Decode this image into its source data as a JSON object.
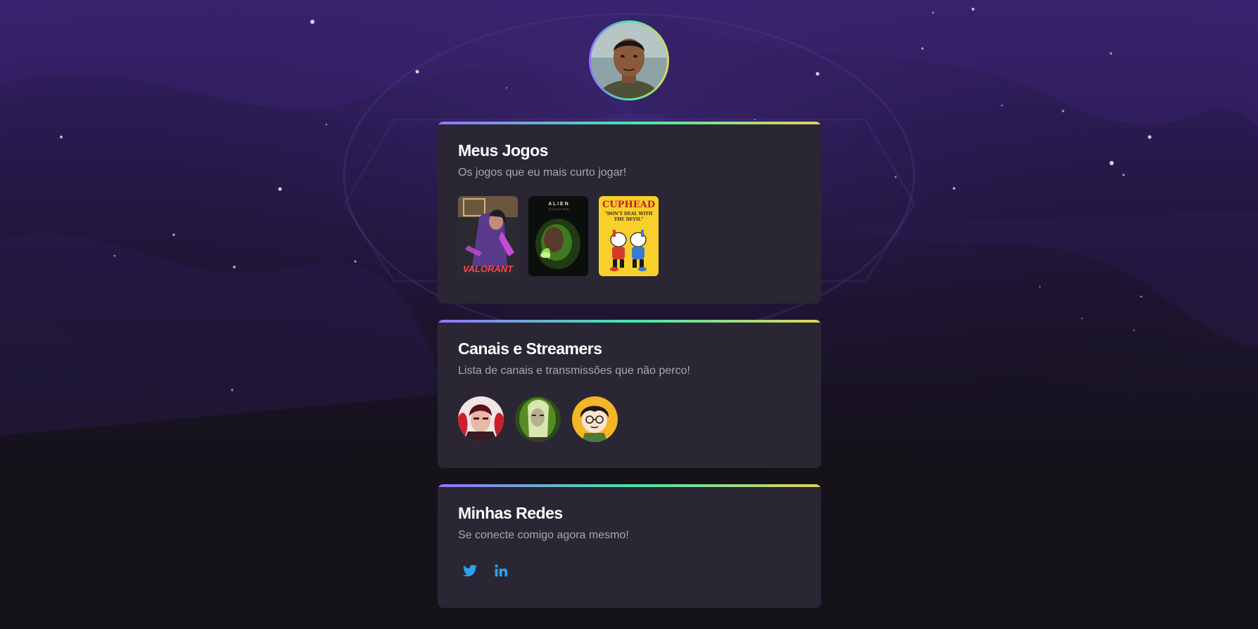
{
  "colors": {
    "card_bg": "#2a2634",
    "gradient": [
      "#9572fc",
      "#43e7ad",
      "#e2d45c"
    ],
    "title": "#ffffff",
    "subtitle": "#a8a8b3",
    "social_icon": "#2fa1ec"
  },
  "profile": {
    "avatar_icon": "profile-photo"
  },
  "games_section": {
    "title": "Meus Jogos",
    "subtitle": "Os jogos que eu mais curto jogar!",
    "games": [
      {
        "icon": "valorant-cover",
        "logo_text": "VALORANT"
      },
      {
        "icon": "alien-isolation-cover",
        "logo_text": "A L I E N"
      },
      {
        "icon": "cuphead-cover",
        "logo_text": "CUPHEAD"
      }
    ]
  },
  "streams_section": {
    "title": "Canais e Streamers",
    "subtitle": "Lista de canais e transmissões que não perco!",
    "streamers": [
      {
        "icon": "streamer-avatar-red"
      },
      {
        "icon": "streamer-avatar-green"
      },
      {
        "icon": "streamer-avatar-yellow"
      }
    ]
  },
  "socials_section": {
    "title": "Minhas Redes",
    "subtitle": "Se conecte comigo agora mesmo!",
    "links": [
      {
        "icon": "twitter-icon"
      },
      {
        "icon": "linkedin-icon"
      }
    ]
  }
}
